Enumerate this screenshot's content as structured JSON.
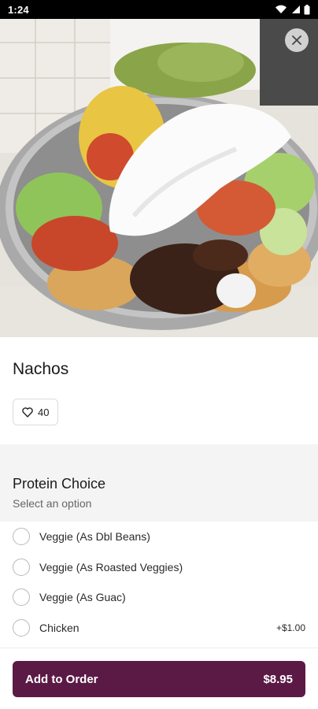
{
  "status_bar": {
    "time": "1:24",
    "icons": [
      "wifi-icon",
      "signal-icon",
      "battery-icon"
    ]
  },
  "hero": {
    "close_icon": "close-icon"
  },
  "item": {
    "name": "Nachos",
    "likes": "40",
    "like_icon": "heart-icon"
  },
  "section": {
    "title": "Protein Choice",
    "subtitle": "Select an option"
  },
  "options": [
    {
      "label": "Veggie (As Dbl Beans)",
      "price": ""
    },
    {
      "label": "Veggie (As Roasted Veggies)",
      "price": ""
    },
    {
      "label": "Veggie (As Guac)",
      "price": ""
    },
    {
      "label": "Chicken",
      "price": "+$1.00"
    }
  ],
  "cta": {
    "label": "Add to Order",
    "price": "$8.95"
  },
  "colors": {
    "accent": "#5b1a45",
    "section_bg": "#f4f4f4",
    "status_bar": "#000000"
  }
}
